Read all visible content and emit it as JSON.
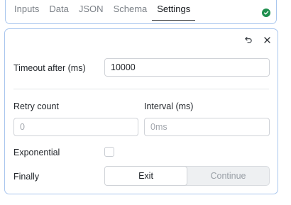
{
  "tabs": [
    {
      "label": "Inputs",
      "active": false
    },
    {
      "label": "Data",
      "active": false
    },
    {
      "label": "JSON",
      "active": false
    },
    {
      "label": "Schema",
      "active": false
    },
    {
      "label": "Settings",
      "active": true
    }
  ],
  "status_icon": "check-circle-icon",
  "status_color": "#1f8f4e",
  "settings": {
    "timeout_label": "Timeout after (ms)",
    "timeout_value": "10000",
    "retry_label": "Retry count",
    "retry_placeholder": "0",
    "interval_label": "Interval (ms)",
    "interval_placeholder": "0ms",
    "exponential_label": "Exponential",
    "exponential_checked": false,
    "finally_label": "Finally",
    "finally_options": [
      "Exit",
      "Continue"
    ],
    "finally_selected": "Exit"
  },
  "actions": {
    "undo_icon": "undo-icon",
    "close_icon": "close-icon"
  }
}
